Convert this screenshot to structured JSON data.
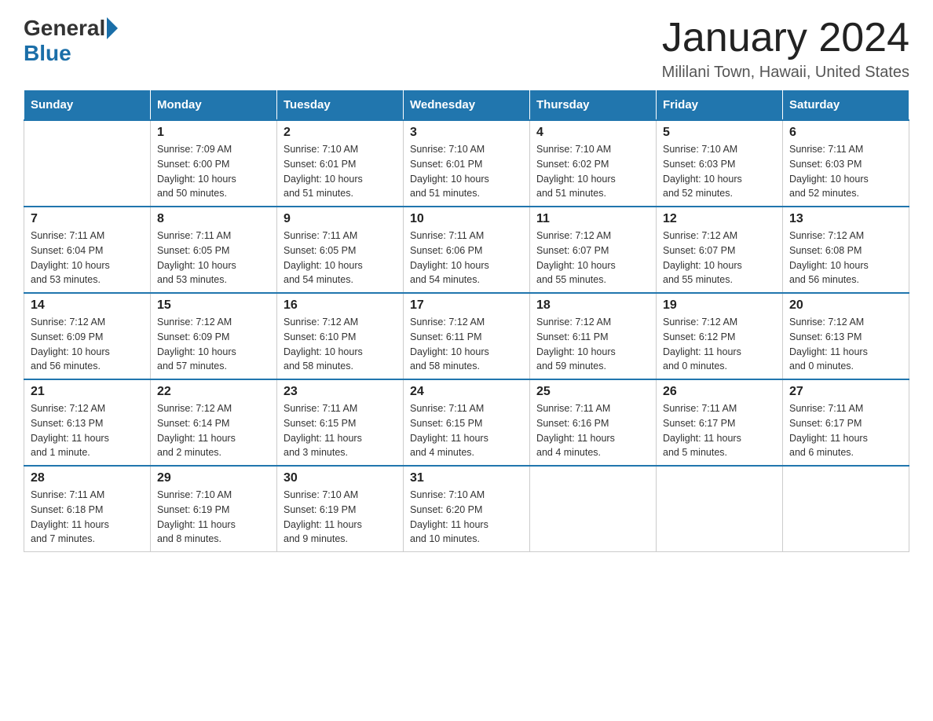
{
  "header": {
    "logo_general": "General",
    "logo_blue": "Blue",
    "month_title": "January 2024",
    "location": "Mililani Town, Hawaii, United States"
  },
  "calendar": {
    "days_of_week": [
      "Sunday",
      "Monday",
      "Tuesday",
      "Wednesday",
      "Thursday",
      "Friday",
      "Saturday"
    ],
    "weeks": [
      [
        {
          "day": "",
          "info": ""
        },
        {
          "day": "1",
          "info": "Sunrise: 7:09 AM\nSunset: 6:00 PM\nDaylight: 10 hours\nand 50 minutes."
        },
        {
          "day": "2",
          "info": "Sunrise: 7:10 AM\nSunset: 6:01 PM\nDaylight: 10 hours\nand 51 minutes."
        },
        {
          "day": "3",
          "info": "Sunrise: 7:10 AM\nSunset: 6:01 PM\nDaylight: 10 hours\nand 51 minutes."
        },
        {
          "day": "4",
          "info": "Sunrise: 7:10 AM\nSunset: 6:02 PM\nDaylight: 10 hours\nand 51 minutes."
        },
        {
          "day": "5",
          "info": "Sunrise: 7:10 AM\nSunset: 6:03 PM\nDaylight: 10 hours\nand 52 minutes."
        },
        {
          "day": "6",
          "info": "Sunrise: 7:11 AM\nSunset: 6:03 PM\nDaylight: 10 hours\nand 52 minutes."
        }
      ],
      [
        {
          "day": "7",
          "info": "Sunrise: 7:11 AM\nSunset: 6:04 PM\nDaylight: 10 hours\nand 53 minutes."
        },
        {
          "day": "8",
          "info": "Sunrise: 7:11 AM\nSunset: 6:05 PM\nDaylight: 10 hours\nand 53 minutes."
        },
        {
          "day": "9",
          "info": "Sunrise: 7:11 AM\nSunset: 6:05 PM\nDaylight: 10 hours\nand 54 minutes."
        },
        {
          "day": "10",
          "info": "Sunrise: 7:11 AM\nSunset: 6:06 PM\nDaylight: 10 hours\nand 54 minutes."
        },
        {
          "day": "11",
          "info": "Sunrise: 7:12 AM\nSunset: 6:07 PM\nDaylight: 10 hours\nand 55 minutes."
        },
        {
          "day": "12",
          "info": "Sunrise: 7:12 AM\nSunset: 6:07 PM\nDaylight: 10 hours\nand 55 minutes."
        },
        {
          "day": "13",
          "info": "Sunrise: 7:12 AM\nSunset: 6:08 PM\nDaylight: 10 hours\nand 56 minutes."
        }
      ],
      [
        {
          "day": "14",
          "info": "Sunrise: 7:12 AM\nSunset: 6:09 PM\nDaylight: 10 hours\nand 56 minutes."
        },
        {
          "day": "15",
          "info": "Sunrise: 7:12 AM\nSunset: 6:09 PM\nDaylight: 10 hours\nand 57 minutes."
        },
        {
          "day": "16",
          "info": "Sunrise: 7:12 AM\nSunset: 6:10 PM\nDaylight: 10 hours\nand 58 minutes."
        },
        {
          "day": "17",
          "info": "Sunrise: 7:12 AM\nSunset: 6:11 PM\nDaylight: 10 hours\nand 58 minutes."
        },
        {
          "day": "18",
          "info": "Sunrise: 7:12 AM\nSunset: 6:11 PM\nDaylight: 10 hours\nand 59 minutes."
        },
        {
          "day": "19",
          "info": "Sunrise: 7:12 AM\nSunset: 6:12 PM\nDaylight: 11 hours\nand 0 minutes."
        },
        {
          "day": "20",
          "info": "Sunrise: 7:12 AM\nSunset: 6:13 PM\nDaylight: 11 hours\nand 0 minutes."
        }
      ],
      [
        {
          "day": "21",
          "info": "Sunrise: 7:12 AM\nSunset: 6:13 PM\nDaylight: 11 hours\nand 1 minute."
        },
        {
          "day": "22",
          "info": "Sunrise: 7:12 AM\nSunset: 6:14 PM\nDaylight: 11 hours\nand 2 minutes."
        },
        {
          "day": "23",
          "info": "Sunrise: 7:11 AM\nSunset: 6:15 PM\nDaylight: 11 hours\nand 3 minutes."
        },
        {
          "day": "24",
          "info": "Sunrise: 7:11 AM\nSunset: 6:15 PM\nDaylight: 11 hours\nand 4 minutes."
        },
        {
          "day": "25",
          "info": "Sunrise: 7:11 AM\nSunset: 6:16 PM\nDaylight: 11 hours\nand 4 minutes."
        },
        {
          "day": "26",
          "info": "Sunrise: 7:11 AM\nSunset: 6:17 PM\nDaylight: 11 hours\nand 5 minutes."
        },
        {
          "day": "27",
          "info": "Sunrise: 7:11 AM\nSunset: 6:17 PM\nDaylight: 11 hours\nand 6 minutes."
        }
      ],
      [
        {
          "day": "28",
          "info": "Sunrise: 7:11 AM\nSunset: 6:18 PM\nDaylight: 11 hours\nand 7 minutes."
        },
        {
          "day": "29",
          "info": "Sunrise: 7:10 AM\nSunset: 6:19 PM\nDaylight: 11 hours\nand 8 minutes."
        },
        {
          "day": "30",
          "info": "Sunrise: 7:10 AM\nSunset: 6:19 PM\nDaylight: 11 hours\nand 9 minutes."
        },
        {
          "day": "31",
          "info": "Sunrise: 7:10 AM\nSunset: 6:20 PM\nDaylight: 11 hours\nand 10 minutes."
        },
        {
          "day": "",
          "info": ""
        },
        {
          "day": "",
          "info": ""
        },
        {
          "day": "",
          "info": ""
        }
      ]
    ]
  }
}
